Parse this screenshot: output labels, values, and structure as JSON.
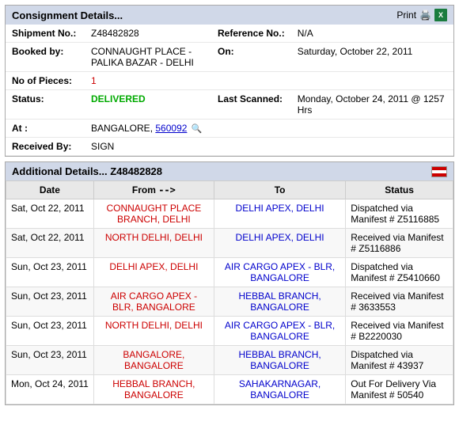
{
  "consignment": {
    "header": "Consignment Details...",
    "print_label": "Print",
    "shipment_label": "Shipment No.:",
    "shipment_value": "Z48482828",
    "reference_label": "Reference No.:",
    "reference_value": "N/A",
    "booked_label": "Booked by:",
    "booked_value": "CONNAUGHT PLACE - PALIKA BAZAR - DELHI",
    "on_label": "On:",
    "on_value": "Saturday, October 22, 2011",
    "pieces_label": "No of Pieces:",
    "pieces_value": "1",
    "status_label": "Status:",
    "status_value": "DELIVERED",
    "last_scanned_label": "Last Scanned:",
    "last_scanned_value": "Monday, October 24, 2011 @ 1257 Hrs",
    "at_label": "At :",
    "at_city": "BANGALORE,",
    "at_pin": "560092",
    "received_label": "Received By:",
    "received_value": "SIGN"
  },
  "additional": {
    "header": "Additional Details... Z48482828",
    "col_date": "Date",
    "col_from": "From",
    "col_arrow": "-->",
    "col_to": "To",
    "col_status": "Status",
    "rows": [
      {
        "date": "Sat, Oct 22, 2011",
        "from": "CONNAUGHT PLACE BRANCH, DELHI",
        "to": "DELHI APEX, DELHI",
        "status": "Dispatched via Manifest # Z5116885"
      },
      {
        "date": "Sat, Oct 22, 2011",
        "from": "NORTH DELHI, DELHI",
        "to": "DELHI APEX, DELHI",
        "status": "Received via Manifest # Z5116886"
      },
      {
        "date": "Sun, Oct 23, 2011",
        "from": "DELHI APEX, DELHI",
        "to": "AIR CARGO APEX - BLR, BANGALORE",
        "status": "Dispatched via Manifest # Z5410660"
      },
      {
        "date": "Sun, Oct 23, 2011",
        "from": "AIR CARGO APEX - BLR, BANGALORE",
        "to": "HEBBAL BRANCH, BANGALORE",
        "status": "Received via Manifest # 3633553"
      },
      {
        "date": "Sun, Oct 23, 2011",
        "from": "NORTH DELHI, DELHI",
        "to": "AIR CARGO APEX - BLR, BANGALORE",
        "status": "Received via Manifest # B2220030"
      },
      {
        "date": "Sun, Oct 23, 2011",
        "from": "BANGALORE, BANGALORE",
        "to": "HEBBAL BRANCH, BANGALORE",
        "status": "Dispatched via Manifest # 43937"
      },
      {
        "date": "Mon, Oct 24, 2011",
        "from": "HEBBAL BRANCH, BANGALORE",
        "to": "SAHAKARNAGAR, BANGALORE",
        "status": "Out For Delivery Via Manifest # 50540"
      }
    ]
  }
}
